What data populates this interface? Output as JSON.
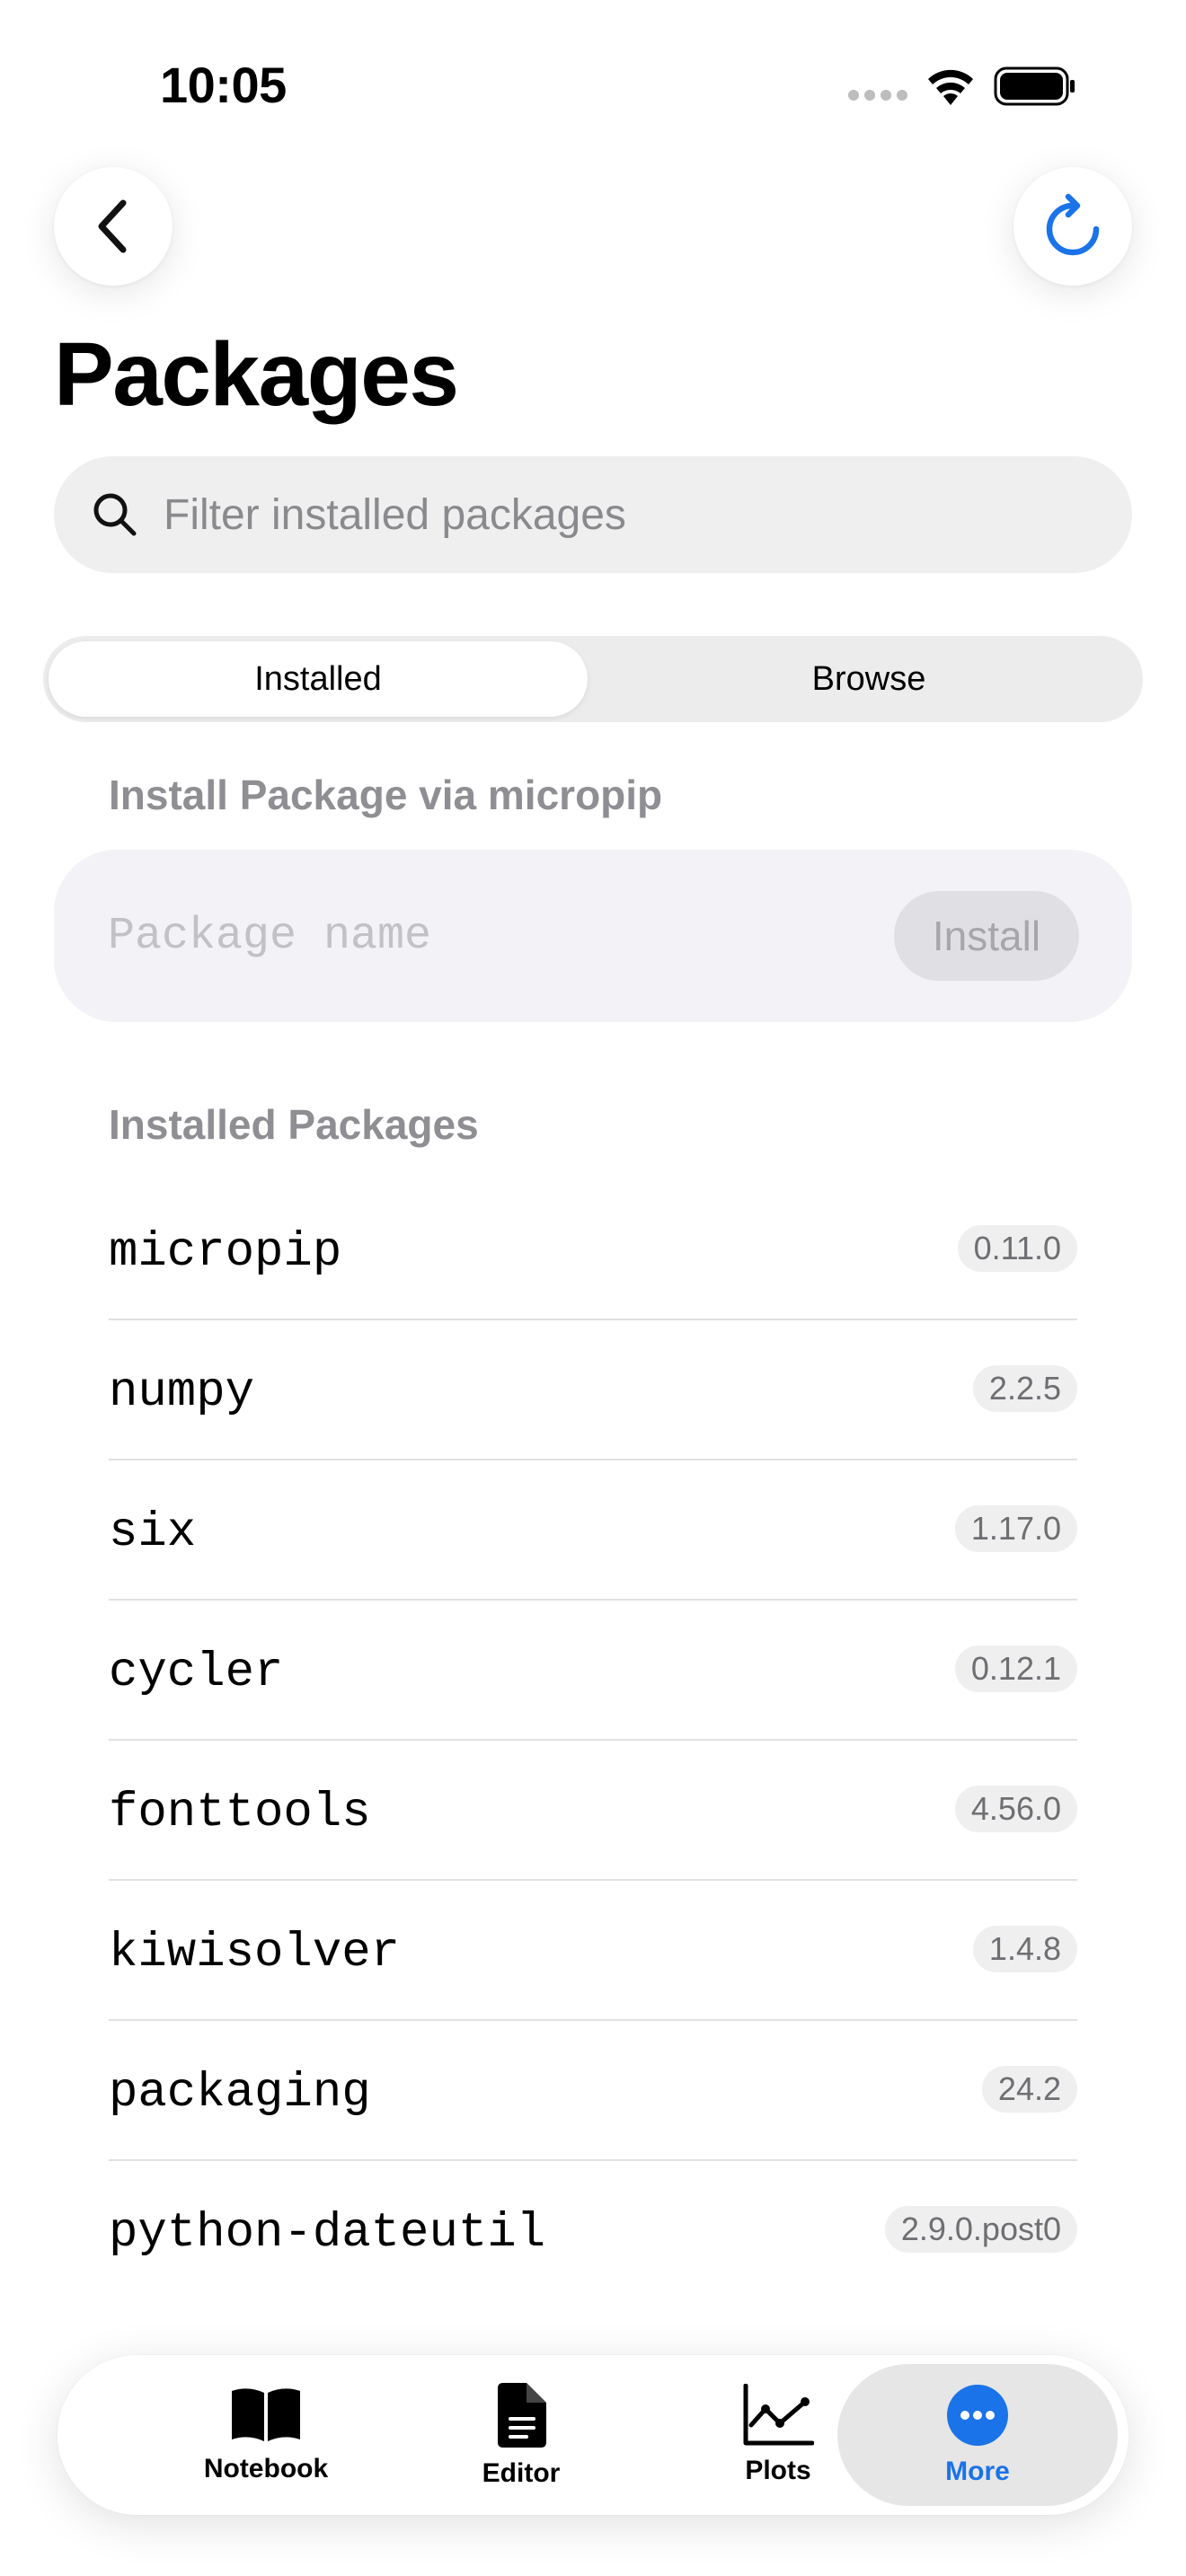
{
  "status": {
    "time": "10:05"
  },
  "header": {
    "title": "Packages"
  },
  "search": {
    "placeholder": "Filter installed packages"
  },
  "segments": {
    "installed": "Installed",
    "browse": "Browse"
  },
  "install": {
    "section_label": "Install Package via micropip",
    "placeholder": "Package name",
    "button_label": "Install"
  },
  "installed": {
    "section_label": "Installed Packages",
    "packages": [
      {
        "name": "micropip",
        "version": "0.11.0"
      },
      {
        "name": "numpy",
        "version": "2.2.5"
      },
      {
        "name": "six",
        "version": "1.17.0"
      },
      {
        "name": "cycler",
        "version": "0.12.1"
      },
      {
        "name": "fonttools",
        "version": "4.56.0"
      },
      {
        "name": "kiwisolver",
        "version": "1.4.8"
      },
      {
        "name": "packaging",
        "version": "24.2"
      },
      {
        "name": "python-dateutil",
        "version": "2.9.0.post0"
      }
    ]
  },
  "tabbar": {
    "notebook": "Notebook",
    "editor": "Editor",
    "plots": "Plots",
    "more": "More"
  },
  "colors": {
    "accent": "#1a73e8"
  }
}
